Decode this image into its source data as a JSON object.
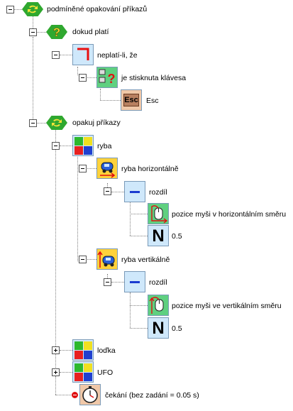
{
  "tree": {
    "root": "podmíněné opakování příkazů",
    "while": "dokud platí",
    "not": "neplatí-li, že",
    "keypressed": "je stisknuta klávesa",
    "esc_key": "Esc",
    "esc_label": "Esc",
    "repeat": "opakuj příkazy",
    "fish": "ryba",
    "fish_h": "ryba horizontálně",
    "diff1": "rozdíl",
    "mouse_x": "pozice myši v horizontálním směru",
    "n1_sym": "N",
    "n1": "0.5",
    "fish_v": "ryba vertikálně",
    "diff2": "rozdíl",
    "mouse_y": "pozice myši ve vertikálním směru",
    "n2_sym": "N",
    "n2": "0.5",
    "boat": "loďka",
    "ufo": "UFO",
    "wait": "čekání (bez zadání = 0.05 s)"
  },
  "colors": {
    "hex_green": "#2fa82f",
    "tile_blue_bg": "#cfe8fb",
    "tile_green_bg": "#5fd080",
    "tile_yellow_bg": "#ffd23a",
    "wait_bg": "#f0c8a8"
  }
}
